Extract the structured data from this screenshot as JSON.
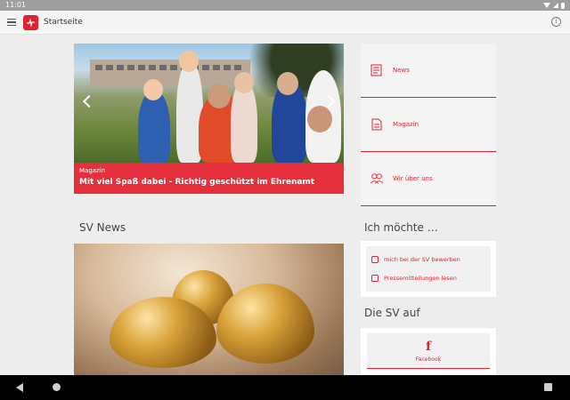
{
  "status_bar": {
    "time": "11:01"
  },
  "app_bar": {
    "title": "Startseite"
  },
  "hero": {
    "category": "Magazin",
    "headline": "Mit viel Spaß dabei - Richtig geschützt im Ehrenamt"
  },
  "nav_cards": [
    {
      "label": "News",
      "icon": "newspaper-icon"
    },
    {
      "label": "Magazin",
      "icon": "document-icon"
    },
    {
      "label": "Wir über uns",
      "icon": "people-icon"
    }
  ],
  "sections": {
    "news_title": "SV News",
    "ich_moechte_title": "Ich möchte …",
    "sv_auf_title": "Die SV auf"
  },
  "actions": [
    {
      "label": "mich bei der SV bewerben",
      "icon": "person-icon"
    },
    {
      "label": "Pressemitteilungen lesen",
      "icon": "mail-icon"
    }
  ],
  "social": {
    "facebook_label": "Facebook",
    "icon": "facebook-icon"
  },
  "colors": {
    "brand_red": "#e4202e",
    "background": "#ededed"
  }
}
